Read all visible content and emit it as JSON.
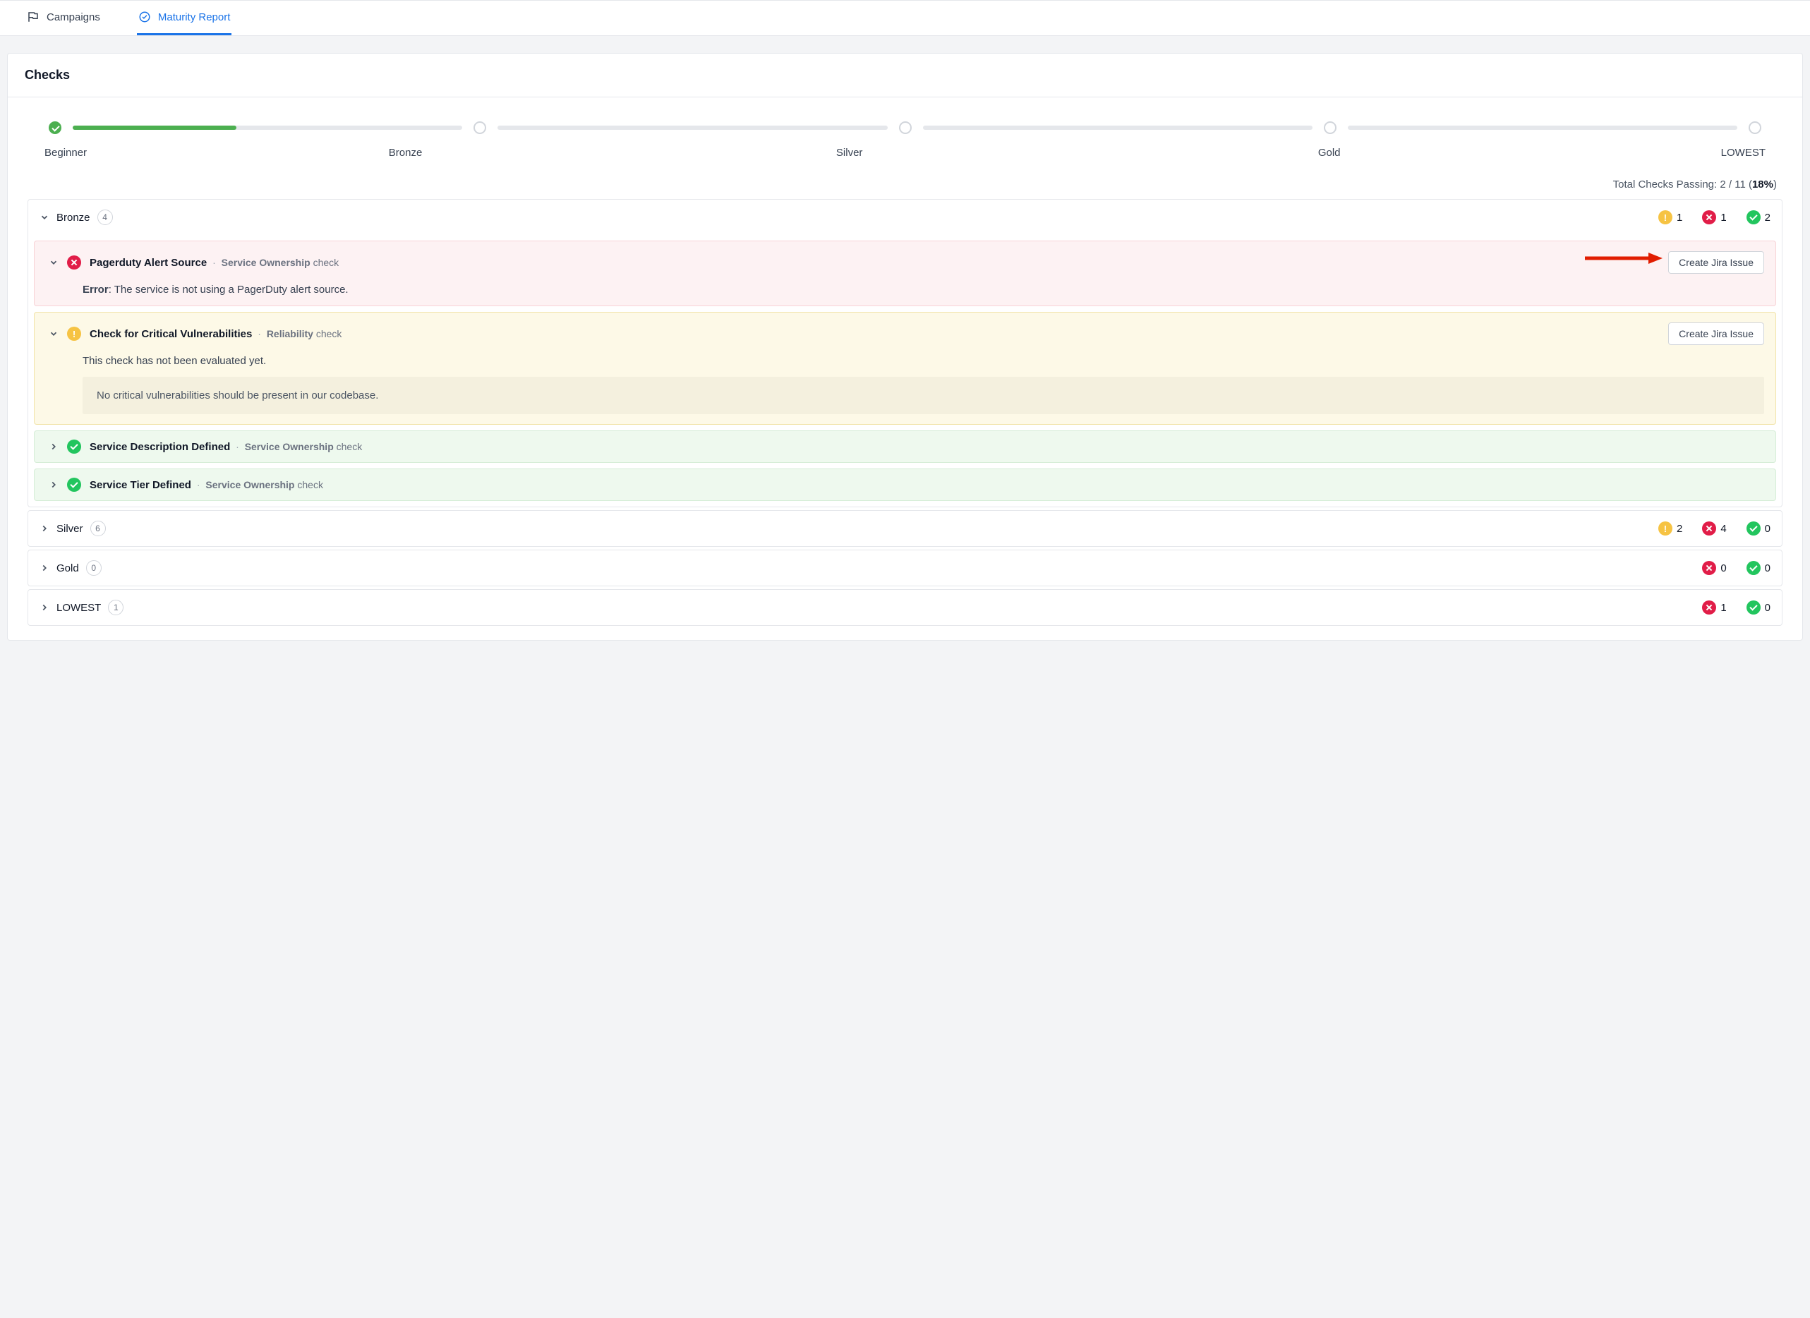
{
  "tabs": {
    "campaigns": "Campaigns",
    "maturity": "Maturity Report"
  },
  "panel_title": "Checks",
  "stages": [
    "Beginner",
    "Bronze",
    "Silver",
    "Gold",
    "LOWEST"
  ],
  "progress_fill_pct": 42,
  "totals": {
    "prefix": "Total Checks Passing: ",
    "passing": "2",
    "sep": " / ",
    "total": "11",
    "pct_open": " (",
    "pct": "18%",
    "pct_close": ")"
  },
  "bronze": {
    "name": "Bronze",
    "count": "4",
    "stats": {
      "warn": "1",
      "err": "1",
      "ok": "2"
    },
    "items": [
      {
        "kind": "err",
        "title": "Pagerduty Alert Source",
        "category": "Service Ownership",
        "suffix": "check",
        "button": "Create Jira Issue",
        "body_label": "Error",
        "body_sep": ": ",
        "body_text": "The service is not using a PagerDuty alert source.",
        "expanded": true,
        "arrow": true
      },
      {
        "kind": "warn",
        "title": "Check for Critical Vulnerabilities",
        "category": "Reliability",
        "suffix": "check",
        "button": "Create Jira Issue",
        "body_text": "This check has not been evaluated yet.",
        "note": "No critical vulnerabilities should be present in our codebase.",
        "expanded": true
      },
      {
        "kind": "ok",
        "title": "Service Description Defined",
        "category": "Service Ownership",
        "suffix": "check",
        "expanded": false
      },
      {
        "kind": "ok",
        "title": "Service Tier Defined",
        "category": "Service Ownership",
        "suffix": "check",
        "expanded": false
      }
    ]
  },
  "levels_collapsed": [
    {
      "name": "Silver",
      "count": "6",
      "stats": {
        "warn": "2",
        "err": "4",
        "ok": "0"
      }
    },
    {
      "name": "Gold",
      "count": "0",
      "stats": {
        "err": "0",
        "ok": "0"
      }
    },
    {
      "name": "LOWEST",
      "count": "1",
      "stats": {
        "err": "1",
        "ok": "0"
      }
    }
  ]
}
